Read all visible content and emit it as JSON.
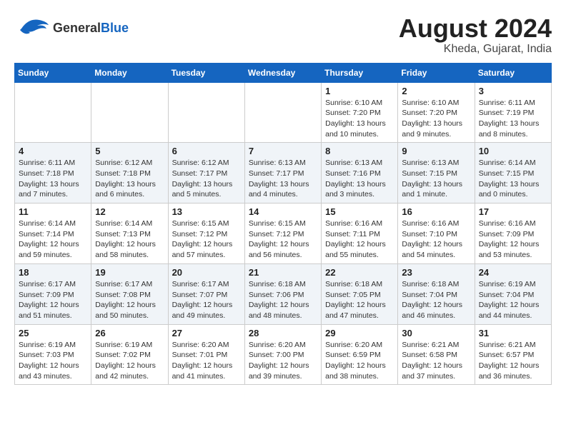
{
  "logo": {
    "general": "General",
    "blue": "Blue"
  },
  "title": {
    "month_year": "August 2024",
    "location": "Kheda, Gujarat, India"
  },
  "header_days": [
    "Sunday",
    "Monday",
    "Tuesday",
    "Wednesday",
    "Thursday",
    "Friday",
    "Saturday"
  ],
  "weeks": [
    {
      "days": [
        {
          "num": "",
          "info": ""
        },
        {
          "num": "",
          "info": ""
        },
        {
          "num": "",
          "info": ""
        },
        {
          "num": "",
          "info": ""
        },
        {
          "num": "1",
          "info": "Sunrise: 6:10 AM\nSunset: 7:20 PM\nDaylight: 13 hours\nand 10 minutes."
        },
        {
          "num": "2",
          "info": "Sunrise: 6:10 AM\nSunset: 7:20 PM\nDaylight: 13 hours\nand 9 minutes."
        },
        {
          "num": "3",
          "info": "Sunrise: 6:11 AM\nSunset: 7:19 PM\nDaylight: 13 hours\nand 8 minutes."
        }
      ]
    },
    {
      "days": [
        {
          "num": "4",
          "info": "Sunrise: 6:11 AM\nSunset: 7:18 PM\nDaylight: 13 hours\nand 7 minutes."
        },
        {
          "num": "5",
          "info": "Sunrise: 6:12 AM\nSunset: 7:18 PM\nDaylight: 13 hours\nand 6 minutes."
        },
        {
          "num": "6",
          "info": "Sunrise: 6:12 AM\nSunset: 7:17 PM\nDaylight: 13 hours\nand 5 minutes."
        },
        {
          "num": "7",
          "info": "Sunrise: 6:13 AM\nSunset: 7:17 PM\nDaylight: 13 hours\nand 4 minutes."
        },
        {
          "num": "8",
          "info": "Sunrise: 6:13 AM\nSunset: 7:16 PM\nDaylight: 13 hours\nand 3 minutes."
        },
        {
          "num": "9",
          "info": "Sunrise: 6:13 AM\nSunset: 7:15 PM\nDaylight: 13 hours\nand 1 minute."
        },
        {
          "num": "10",
          "info": "Sunrise: 6:14 AM\nSunset: 7:15 PM\nDaylight: 13 hours\nand 0 minutes."
        }
      ]
    },
    {
      "days": [
        {
          "num": "11",
          "info": "Sunrise: 6:14 AM\nSunset: 7:14 PM\nDaylight: 12 hours\nand 59 minutes."
        },
        {
          "num": "12",
          "info": "Sunrise: 6:14 AM\nSunset: 7:13 PM\nDaylight: 12 hours\nand 58 minutes."
        },
        {
          "num": "13",
          "info": "Sunrise: 6:15 AM\nSunset: 7:12 PM\nDaylight: 12 hours\nand 57 minutes."
        },
        {
          "num": "14",
          "info": "Sunrise: 6:15 AM\nSunset: 7:12 PM\nDaylight: 12 hours\nand 56 minutes."
        },
        {
          "num": "15",
          "info": "Sunrise: 6:16 AM\nSunset: 7:11 PM\nDaylight: 12 hours\nand 55 minutes."
        },
        {
          "num": "16",
          "info": "Sunrise: 6:16 AM\nSunset: 7:10 PM\nDaylight: 12 hours\nand 54 minutes."
        },
        {
          "num": "17",
          "info": "Sunrise: 6:16 AM\nSunset: 7:09 PM\nDaylight: 12 hours\nand 53 minutes."
        }
      ]
    },
    {
      "days": [
        {
          "num": "18",
          "info": "Sunrise: 6:17 AM\nSunset: 7:09 PM\nDaylight: 12 hours\nand 51 minutes."
        },
        {
          "num": "19",
          "info": "Sunrise: 6:17 AM\nSunset: 7:08 PM\nDaylight: 12 hours\nand 50 minutes."
        },
        {
          "num": "20",
          "info": "Sunrise: 6:17 AM\nSunset: 7:07 PM\nDaylight: 12 hours\nand 49 minutes."
        },
        {
          "num": "21",
          "info": "Sunrise: 6:18 AM\nSunset: 7:06 PM\nDaylight: 12 hours\nand 48 minutes."
        },
        {
          "num": "22",
          "info": "Sunrise: 6:18 AM\nSunset: 7:05 PM\nDaylight: 12 hours\nand 47 minutes."
        },
        {
          "num": "23",
          "info": "Sunrise: 6:18 AM\nSunset: 7:04 PM\nDaylight: 12 hours\nand 46 minutes."
        },
        {
          "num": "24",
          "info": "Sunrise: 6:19 AM\nSunset: 7:04 PM\nDaylight: 12 hours\nand 44 minutes."
        }
      ]
    },
    {
      "days": [
        {
          "num": "25",
          "info": "Sunrise: 6:19 AM\nSunset: 7:03 PM\nDaylight: 12 hours\nand 43 minutes."
        },
        {
          "num": "26",
          "info": "Sunrise: 6:19 AM\nSunset: 7:02 PM\nDaylight: 12 hours\nand 42 minutes."
        },
        {
          "num": "27",
          "info": "Sunrise: 6:20 AM\nSunset: 7:01 PM\nDaylight: 12 hours\nand 41 minutes."
        },
        {
          "num": "28",
          "info": "Sunrise: 6:20 AM\nSunset: 7:00 PM\nDaylight: 12 hours\nand 39 minutes."
        },
        {
          "num": "29",
          "info": "Sunrise: 6:20 AM\nSunset: 6:59 PM\nDaylight: 12 hours\nand 38 minutes."
        },
        {
          "num": "30",
          "info": "Sunrise: 6:21 AM\nSunset: 6:58 PM\nDaylight: 12 hours\nand 37 minutes."
        },
        {
          "num": "31",
          "info": "Sunrise: 6:21 AM\nSunset: 6:57 PM\nDaylight: 12 hours\nand 36 minutes."
        }
      ]
    }
  ]
}
